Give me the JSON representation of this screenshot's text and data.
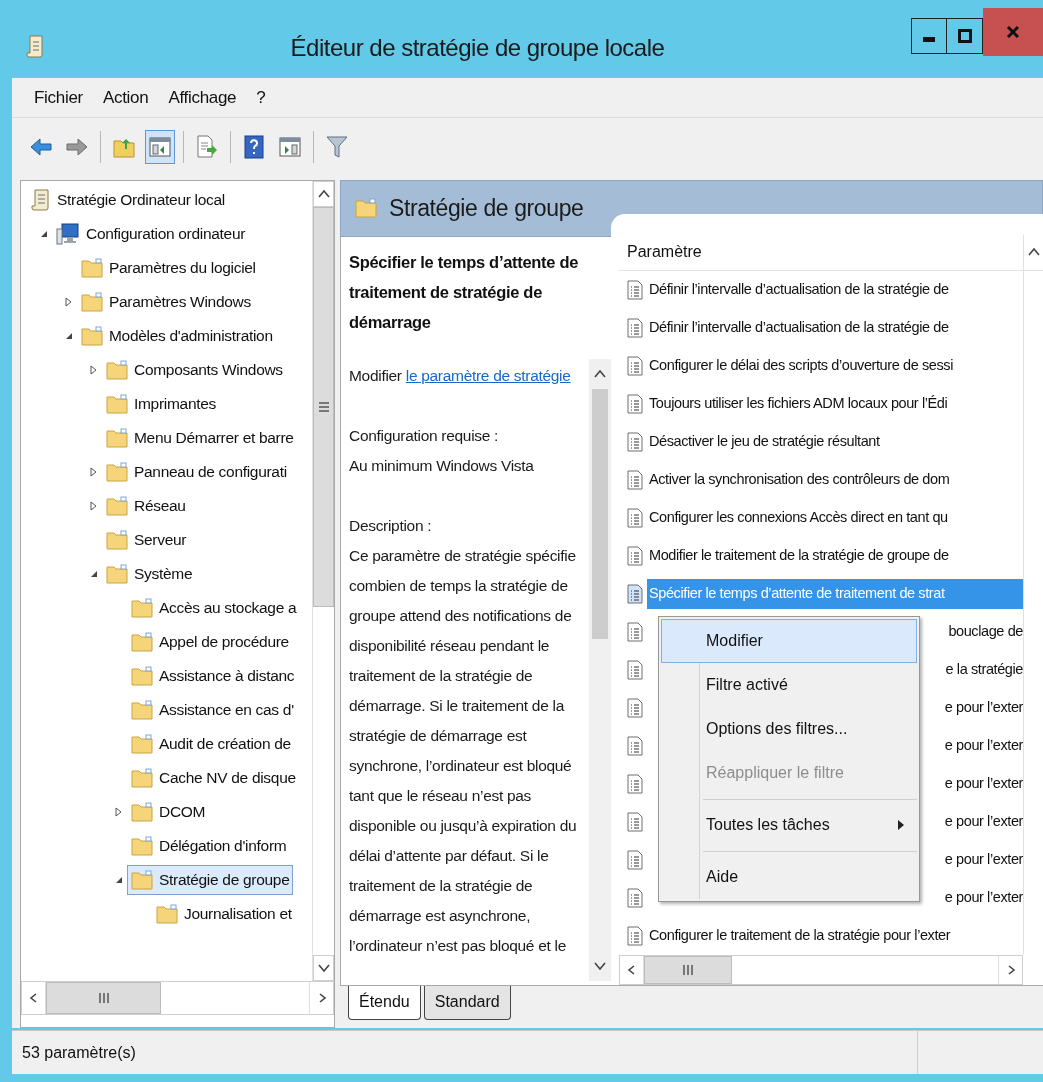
{
  "window": {
    "title": "Éditeur de stratégie de groupe locale"
  },
  "menu": [
    {
      "label": "Fichier"
    },
    {
      "label": "Action"
    },
    {
      "label": "Affichage"
    },
    {
      "label": "?"
    }
  ],
  "toolbar": [
    {
      "kind": "back",
      "pressed": false
    },
    {
      "kind": "forward",
      "pressed": false
    },
    {
      "kind": "separator"
    },
    {
      "kind": "up",
      "pressed": false
    },
    {
      "kind": "console-tree",
      "pressed": true
    },
    {
      "kind": "separator"
    },
    {
      "kind": "export",
      "pressed": false
    },
    {
      "kind": "separator"
    },
    {
      "kind": "help",
      "pressed": false
    },
    {
      "kind": "action-pane",
      "pressed": false
    },
    {
      "kind": "separator"
    },
    {
      "kind": "filter",
      "pressed": false
    }
  ],
  "tree": [
    {
      "label": "Stratégie Ordinateur local",
      "kind": "policy",
      "selected": false,
      "children": [
        {
          "label": "Configuration ordinateur",
          "kind": "computer",
          "expanded": true,
          "selected": false,
          "children": [
            {
              "label": "Paramètres du logiciel",
              "kind": "folder",
              "selected": false
            },
            {
              "label": "Paramètres Windows",
              "kind": "folder",
              "expanded": false,
              "selected": false
            },
            {
              "label": "Modèles d'administration",
              "kind": "folder",
              "expanded": true,
              "selected": false,
              "children": [
                {
                  "label": "Composants Windows",
                  "kind": "folder",
                  "expanded": false,
                  "selected": false
                },
                {
                  "label": "Imprimantes",
                  "kind": "folder",
                  "selected": false
                },
                {
                  "label": "Menu Démarrer et barre",
                  "kind": "folder",
                  "selected": false
                },
                {
                  "label": "Panneau de configurati",
                  "kind": "folder",
                  "expanded": false,
                  "selected": false
                },
                {
                  "label": "Réseau",
                  "kind": "folder",
                  "expanded": false,
                  "selected": false
                },
                {
                  "label": "Serveur",
                  "kind": "folder",
                  "selected": false
                },
                {
                  "label": "Système",
                  "kind": "folder",
                  "expanded": true,
                  "selected": false,
                  "children": [
                    {
                      "label": "Accès au stockage a",
                      "kind": "folder",
                      "selected": false
                    },
                    {
                      "label": "Appel de procédure",
                      "kind": "folder",
                      "selected": false
                    },
                    {
                      "label": "Assistance à distanc",
                      "kind": "folder",
                      "selected": false
                    },
                    {
                      "label": "Assistance en cas d'",
                      "kind": "folder",
                      "selected": false
                    },
                    {
                      "label": "Audit de création de",
                      "kind": "folder",
                      "selected": false
                    },
                    {
                      "label": "Cache NV de disque",
                      "kind": "folder",
                      "selected": false
                    },
                    {
                      "label": "DCOM",
                      "kind": "folder",
                      "expanded": false,
                      "selected": false
                    },
                    {
                      "label": "Délégation d'inform",
                      "kind": "folder",
                      "selected": false
                    },
                    {
                      "label": "Stratégie de groupe",
                      "kind": "folder",
                      "expanded": true,
                      "selected": true,
                      "children": [
                        {
                          "label": "Journalisation et",
                          "kind": "folder",
                          "selected": false
                        }
                      ]
                    }
                  ]
                }
              ]
            }
          ]
        }
      ]
    }
  ],
  "details": {
    "heading": "Stratégie de groupe",
    "title": "Spécifier le temps d’attente de traitement de stratégie de démarrage",
    "edit_prefix": "Modifier",
    "edit_link": "le paramètre de stratégie",
    "requirement_label": "Configuration requise :",
    "requirement": "Au minimum Windows Vista",
    "description_label": "Description :",
    "description": "Ce paramètre de stratégie spécifie combien de temps la stratégie de groupe attend des notifications de disponibilité réseau pendant le traitement de la stratégie de démarrage. Si le traitement de la stratégie de démarrage est synchrone, l’ordinateur est bloqué tant que le réseau n’est pas disponible ou jusqu’à expiration du délai d’attente par défaut. Si le traitement de la stratégie de démarrage est asynchrone, l’ordinateur n’est pas bloqué et le"
  },
  "list": {
    "column": "Paramètre",
    "rows": [
      {
        "text": "Définir l’intervalle d’actualisation de la stratégie de",
        "kind": "full",
        "selected": false
      },
      {
        "text": "Définir l’intervalle d’actualisation de la stratégie de",
        "kind": "full",
        "selected": false
      },
      {
        "text": "Configurer le délai des scripts d’ouverture de sessi",
        "kind": "full",
        "selected": false
      },
      {
        "text": "Toujours utiliser les fichiers ADM locaux pour l’Édi",
        "kind": "full",
        "selected": false
      },
      {
        "text": "Désactiver le jeu de stratégie résultant",
        "kind": "full",
        "selected": false
      },
      {
        "text": "Activer la synchronisation des contrôleurs de dom",
        "kind": "full",
        "selected": false
      },
      {
        "text": "Configurer les connexions Accès direct en tant qu",
        "kind": "full",
        "selected": false
      },
      {
        "text": "Modifier le traitement de la stratégie de groupe de",
        "kind": "full",
        "selected": false
      },
      {
        "text": "Spécifier le temps d’attente de traitement de strat",
        "kind": "full",
        "selected": true
      },
      {
        "text": "bouclage de",
        "kind": "covered",
        "selected": false
      },
      {
        "text": "e la stratégie",
        "kind": "covered",
        "selected": false
      },
      {
        "text": "e pour l’exter",
        "kind": "covered",
        "selected": false
      },
      {
        "text": "e pour l’exter",
        "kind": "covered",
        "selected": false
      },
      {
        "text": "e pour l’exter",
        "kind": "covered",
        "selected": false
      },
      {
        "text": "e pour l’exter",
        "kind": "covered",
        "selected": false
      },
      {
        "text": "e pour l’exter",
        "kind": "covered",
        "selected": false
      },
      {
        "text": "e pour l’exter",
        "kind": "covered",
        "selected": false
      },
      {
        "text": "Configurer le traitement de la stratégie pour l’exter",
        "kind": "full",
        "selected": false
      }
    ]
  },
  "context_menu": [
    {
      "kind": "item",
      "label": "Modifier",
      "selected": true,
      "disabled": false,
      "submenu": false
    },
    {
      "kind": "item",
      "label": "Filtre activé",
      "selected": false,
      "disabled": false,
      "submenu": false
    },
    {
      "kind": "item",
      "label": "Options des filtres...",
      "selected": false,
      "disabled": false,
      "submenu": false
    },
    {
      "kind": "item",
      "label": "Réappliquer le filtre",
      "selected": false,
      "disabled": true,
      "submenu": false
    },
    {
      "kind": "separator"
    },
    {
      "kind": "item",
      "label": "Toutes les tâches",
      "selected": false,
      "disabled": false,
      "submenu": true
    },
    {
      "kind": "separator"
    },
    {
      "kind": "item",
      "label": "Aide",
      "selected": false,
      "disabled": false,
      "submenu": false
    }
  ],
  "tabs": [
    {
      "label": "Étendu",
      "selected": true
    },
    {
      "label": "Standard",
      "selected": false
    }
  ],
  "status_bar": {
    "text": "53 paramètre(s)"
  }
}
